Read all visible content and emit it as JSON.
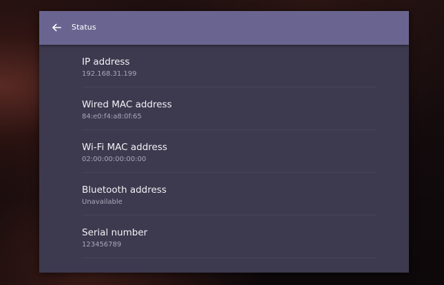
{
  "header": {
    "title": "Status",
    "back_icon": "arrow-left-icon"
  },
  "items": [
    {
      "title": "IP address",
      "value": "192.168.31.199"
    },
    {
      "title": "Wired MAC address",
      "value": "84:e0:f4:a8:0f:65"
    },
    {
      "title": "Wi-Fi MAC address",
      "value": "02:00:00:00:00:00"
    },
    {
      "title": "Bluetooth address",
      "value": "Unavailable"
    },
    {
      "title": "Serial number",
      "value": "123456789"
    }
  ],
  "colors": {
    "header": "#6a6590",
    "panel": "#3d3a4f",
    "divider": "#47445a"
  }
}
